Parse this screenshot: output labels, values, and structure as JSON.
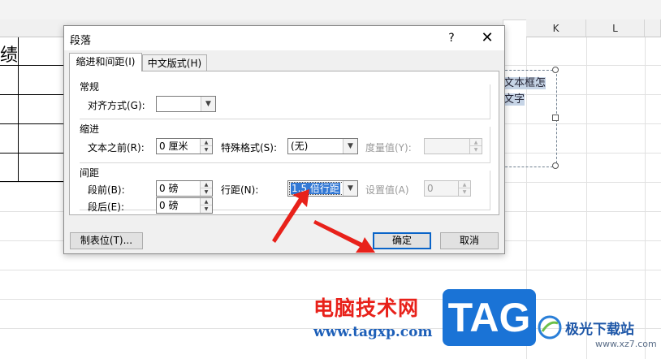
{
  "spreadsheet": {
    "columns": [
      "K",
      "L"
    ],
    "cell_fragment": "绩",
    "textbox_lines": [
      "文本框怎",
      "文字"
    ]
  },
  "dialog": {
    "title": "段落",
    "help_label": "?",
    "close_label": "✕",
    "tabs": [
      {
        "label": "缩进和间距(I)",
        "active": true
      },
      {
        "label": "中文版式(H)",
        "active": false
      }
    ],
    "general": {
      "title": "常规",
      "alignment_label": "对齐方式(G):",
      "alignment_value": ""
    },
    "indent": {
      "title": "缩进",
      "before_text_label": "文本之前(R):",
      "before_text_value": "0 厘米",
      "special_label": "特殊格式(S):",
      "special_value": "(无)",
      "by_label": "度量值(Y):",
      "by_value": ""
    },
    "spacing": {
      "title": "间距",
      "before_label": "段前(B):",
      "before_value": "0 磅",
      "after_label": "段后(E):",
      "after_value": "0 磅",
      "line_label": "行距(N):",
      "line_value": "1.5 倍行距",
      "at_label": "设置值(A)",
      "at_value": "0"
    },
    "buttons": {
      "tabs_label": "制表位(T)...",
      "ok_label": "确定",
      "cancel_label": "取消"
    }
  },
  "watermark": {
    "cn_text": "电脑技术网",
    "url": "www.tagxp.com",
    "tag": "TAG",
    "site_name": "极光下载站",
    "site_url": "www.xz7.com"
  },
  "colors": {
    "annotation_arrow": "#e8211a",
    "selection": "#3379d5",
    "tag_blue": "#1a73d6"
  }
}
